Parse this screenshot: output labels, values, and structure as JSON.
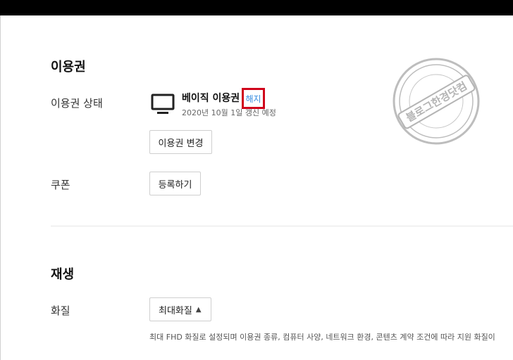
{
  "subscription": {
    "title": "이용권",
    "status_label": "이용권 상태",
    "plan_name": "베이직 이용권",
    "cancel_label": "해지",
    "renewal_text": "2020년 10월 1일 갱신 예정",
    "change_button": "이용권 변경"
  },
  "coupon": {
    "label": "쿠폰",
    "register_button": "등록하기"
  },
  "playback": {
    "title": "재생",
    "quality_label": "화질",
    "quality_selected": "최대화질",
    "quality_note": "최대 FHD 화질로 설정되며 이용권 종류, 컴퓨터 사양, 네트워크 환경, 콘텐츠 계약 조건에 따라 지원 화질이"
  },
  "watermark": {
    "main_text": "블로그한경닷컴",
    "icon": "stamp-watermark"
  },
  "colors": {
    "highlight_border": "#d0021b",
    "link": "#3a8de0",
    "top_bar": "#000000"
  }
}
